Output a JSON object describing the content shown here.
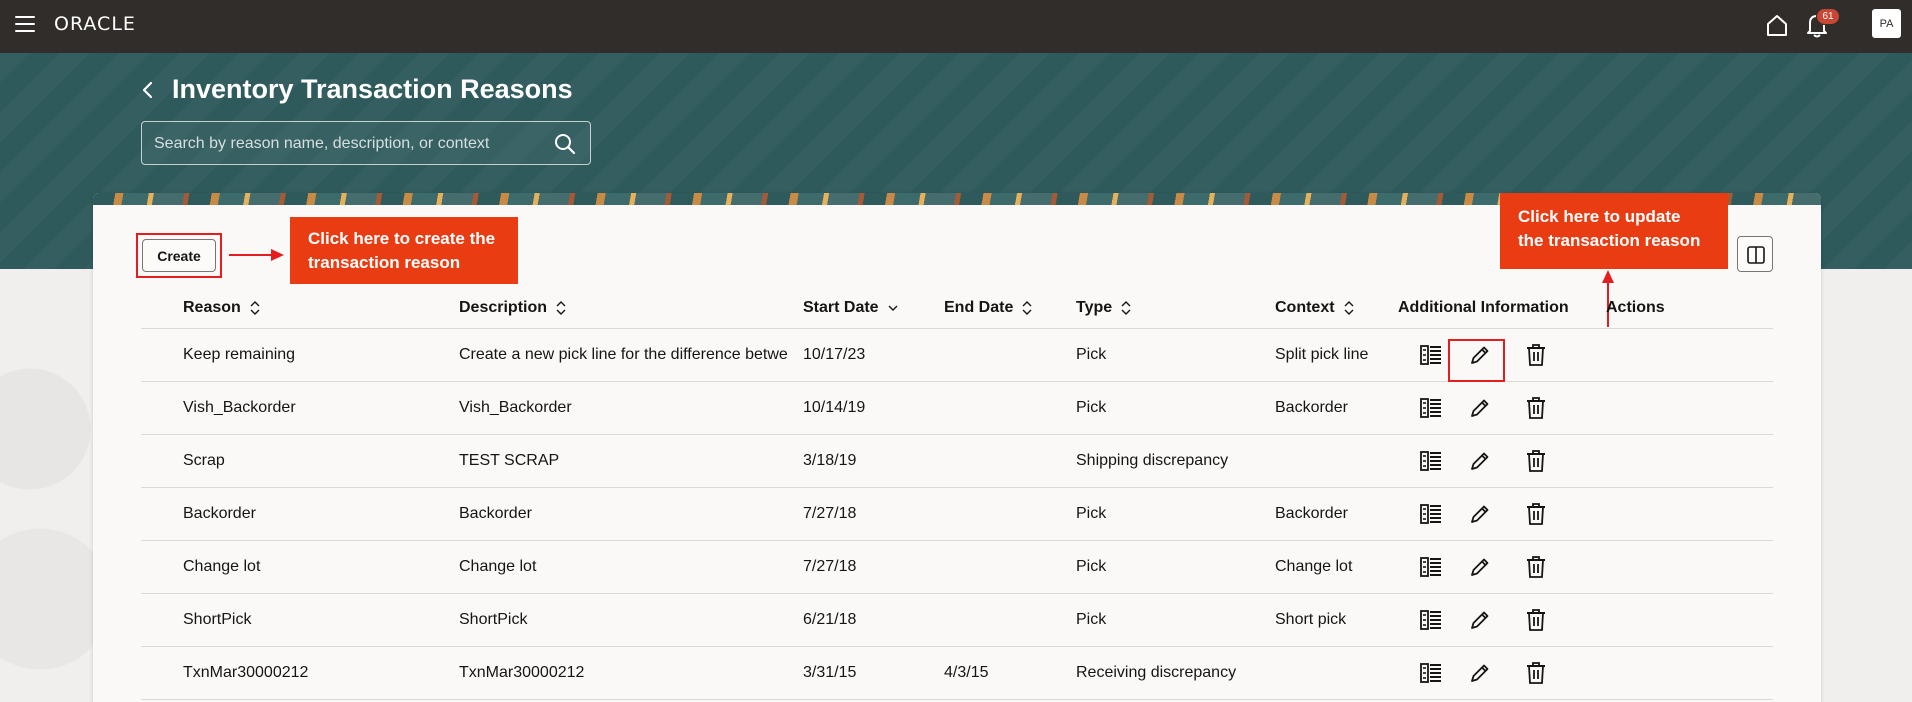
{
  "app": {
    "brand": "ORACLE"
  },
  "topbar": {
    "notification_count": "61",
    "avatar_initials": "PA"
  },
  "page": {
    "title": "Inventory Transaction Reasons",
    "search_placeholder": "Search by reason name, description, or context"
  },
  "toolbar": {
    "create_label": "Create"
  },
  "callouts": {
    "create": "Click here to create the transaction reason",
    "update": "Click here to update the transaction reason"
  },
  "colors": {
    "topbar": "#312d2a",
    "header": "#2f5a5c",
    "callout": "#ea3c12",
    "highlight": "#e41e1e"
  },
  "table": {
    "headers": {
      "reason": "Reason",
      "description": "Description",
      "start_date": "Start Date",
      "end_date": "End Date",
      "type": "Type",
      "context": "Context",
      "additional_info": "Additional Information",
      "actions": "Actions"
    },
    "rows": [
      {
        "reason": "Keep remaining",
        "description": "Create a new pick line for the difference betwe",
        "start_date": "10/17/23",
        "end_date": "",
        "type": "Pick",
        "context": "Split pick line"
      },
      {
        "reason": "Vish_Backorder",
        "description": "Vish_Backorder",
        "start_date": "10/14/19",
        "end_date": "",
        "type": "Pick",
        "context": "Backorder"
      },
      {
        "reason": "Scrap",
        "description": "TEST SCRAP",
        "start_date": "3/18/19",
        "end_date": "",
        "type": "Shipping discrepancy",
        "context": ""
      },
      {
        "reason": "Backorder",
        "description": "Backorder",
        "start_date": "7/27/18",
        "end_date": "",
        "type": "Pick",
        "context": "Backorder"
      },
      {
        "reason": "Change lot",
        "description": "Change lot",
        "start_date": "7/27/18",
        "end_date": "",
        "type": "Pick",
        "context": "Change lot"
      },
      {
        "reason": "ShortPick",
        "description": "ShortPick",
        "start_date": "6/21/18",
        "end_date": "",
        "type": "Pick",
        "context": "Short pick"
      },
      {
        "reason": "TxnMar30000212",
        "description": "TxnMar30000212",
        "start_date": "3/31/15",
        "end_date": "4/3/15",
        "type": "Receiving discrepancy",
        "context": ""
      }
    ]
  }
}
